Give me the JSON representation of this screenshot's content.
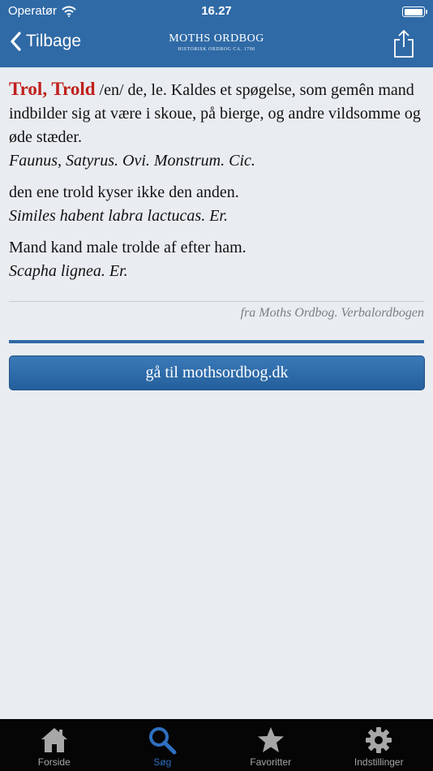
{
  "status": {
    "carrier": "Operatør",
    "time": "16.27"
  },
  "nav": {
    "back_label": "Tilbage",
    "logo_title": "MOTHS ORDBOG",
    "logo_subtitle": "HISTORISK ORDBOG CA. 1700"
  },
  "entry": {
    "headword": "Trol, Trold",
    "definition": " /en/ de, le. Kaldes et spøgelse, som gemên mand indbilder sig at være i skoue, på bierge, og andre vildsomme og øde stæder.",
    "definition_latin": "Faunus, Satyrus. Ovi. Monstrum. Cic.",
    "examples": [
      {
        "text": "den ene trold kyser ikke den anden.",
        "latin": "Similes habent labra lactucas. Er."
      },
      {
        "text": "Mand kand male trolde af efter ham.",
        "latin": "Scapha lignea. Er."
      }
    ],
    "source": "fra Moths Ordbog. Verbalordbogen"
  },
  "site_button": "gå til mothsordbog.dk",
  "tabs": [
    {
      "label": "Forside",
      "icon": "home-icon",
      "active": false
    },
    {
      "label": "Søg",
      "icon": "search-icon",
      "active": true
    },
    {
      "label": "Favoritter",
      "icon": "star-icon",
      "active": false
    },
    {
      "label": "Indstillinger",
      "icon": "gear-icon",
      "active": false
    }
  ],
  "colors": {
    "bar": "#2f6aa6",
    "headword": "#c0201d",
    "tab_active": "#2e6fc0"
  }
}
